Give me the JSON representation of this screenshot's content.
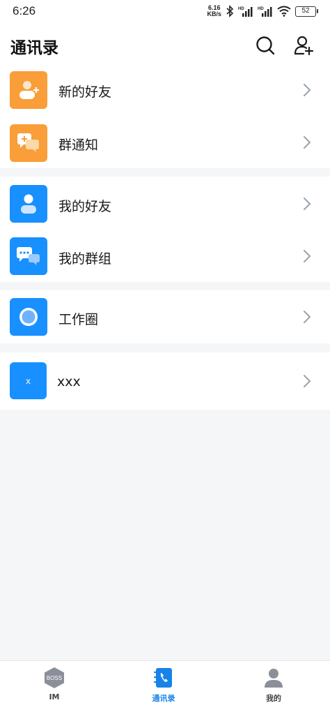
{
  "status_bar": {
    "time": "6:26",
    "net_speed_value": "6.16",
    "net_speed_unit": "KB/s",
    "battery": "52"
  },
  "header": {
    "title": "通讯录"
  },
  "groups": [
    {
      "items": [
        {
          "label": "新的好友",
          "icon": "add-friend-icon",
          "color": "#f99e38"
        },
        {
          "label": "群通知",
          "icon": "group-notice-icon",
          "color": "#f99e38"
        }
      ]
    },
    {
      "items": [
        {
          "label": "我的好友",
          "icon": "friend-icon",
          "color": "#1890ff"
        },
        {
          "label": "我的群组",
          "icon": "group-chat-icon",
          "color": "#1890ff"
        }
      ]
    },
    {
      "items": [
        {
          "label": "工作圈",
          "icon": "work-circle-icon",
          "color": "#1890ff"
        }
      ]
    },
    {
      "items": [
        {
          "label": "xxx",
          "avatar_text": "x",
          "color": "#1890ff"
        }
      ]
    }
  ],
  "bottom_nav": {
    "items": [
      {
        "label": "IM",
        "icon": "boss-hexagon-icon",
        "badge_text": "BOSS",
        "active": false
      },
      {
        "label": "通讯录",
        "icon": "contacts-book-icon",
        "active": true
      },
      {
        "label": "我的",
        "icon": "profile-icon",
        "active": false
      }
    ]
  },
  "colors": {
    "accent": "#1783e8",
    "orange": "#f99e38",
    "blue": "#1890ff",
    "background": "#f5f6f8"
  }
}
